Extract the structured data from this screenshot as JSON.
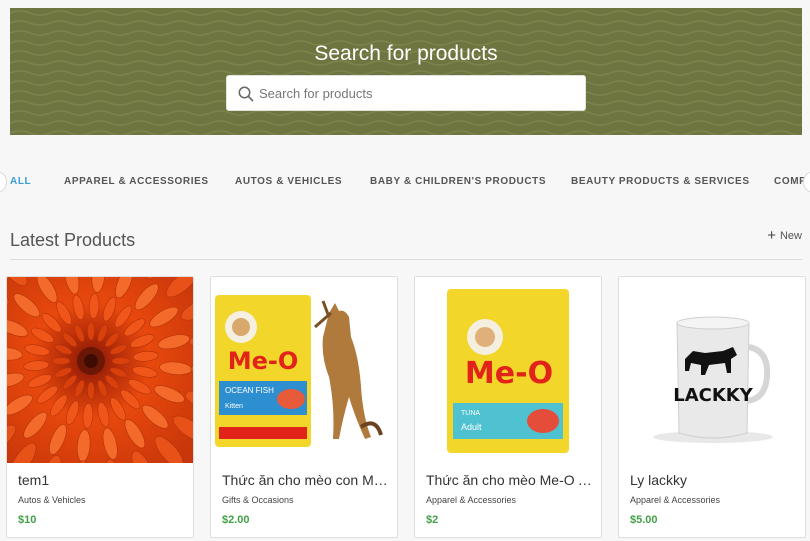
{
  "hero": {
    "title": "Search for products",
    "search_placeholder": "Search for products",
    "background_color": "#6e7540"
  },
  "tabs": [
    {
      "label": "ALL",
      "active": true
    },
    {
      "label": "APPAREL & ACCESSORIES",
      "active": false
    },
    {
      "label": "AUTOS & VEHICLES",
      "active": false
    },
    {
      "label": "BABY & CHILDREN'S PRODUCTS",
      "active": false
    },
    {
      "label": "BEAUTY PRODUCTS & SERVICES",
      "active": false
    },
    {
      "label": "COMP",
      "active": false
    }
  ],
  "section": {
    "title": "Latest Products",
    "new_label": "New"
  },
  "products": [
    {
      "name": "tem1",
      "category": "Autos & Vehicles",
      "price": "$10",
      "image": "orange-flower"
    },
    {
      "name": "Thức ăn cho mèo con Me-O Kitten",
      "category": "Gifts & Occasions",
      "price": "$2.00",
      "image": "cat-food-kitten"
    },
    {
      "name": "Thức ăn cho mèo Me-O Adult",
      "category": "Apparel & Accessories",
      "price": "$2",
      "image": "cat-food-adult"
    },
    {
      "name": "Ly lackky",
      "category": "Apparel & Accessories",
      "price": "$5.00",
      "image": "lackky-mug"
    }
  ],
  "images": {
    "brand_text": "Me-O",
    "kitten_label": "OCEAN FISH",
    "kitten_sub": "Kitten",
    "adult_label": "TUNA",
    "adult_sub": "Adult",
    "mug_text": "LACKKY"
  },
  "colors": {
    "accent": "#3a9fd6",
    "price": "#43a047"
  }
}
